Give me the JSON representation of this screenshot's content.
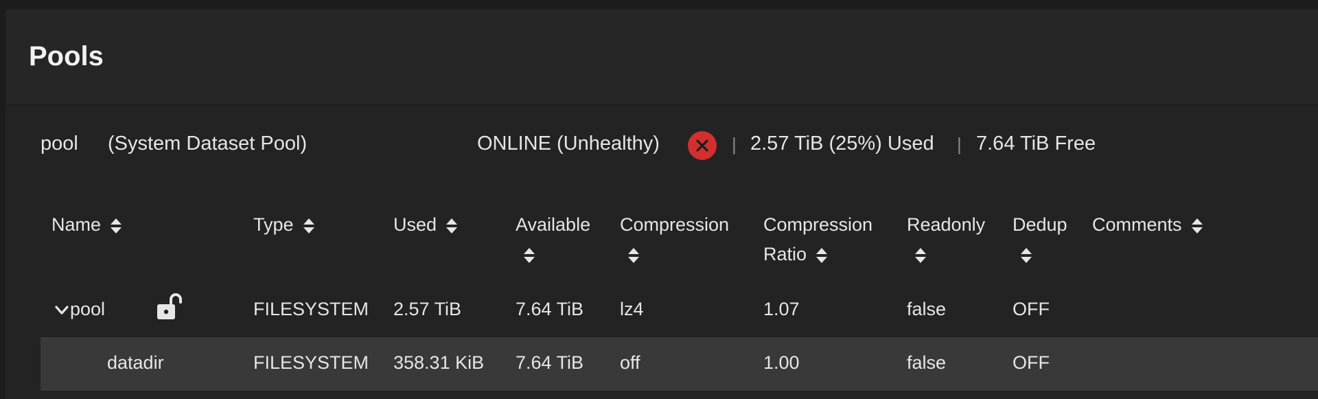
{
  "header": {
    "title": "Pools"
  },
  "pool": {
    "name": "pool",
    "role": "(System Dataset Pool)",
    "status": "ONLINE (Unhealthy)",
    "separator": "|",
    "used": "2.57 TiB (25%) Used",
    "free": "7.64 TiB Free",
    "status_color": "#d32f2f"
  },
  "table": {
    "columns": {
      "name": "Name",
      "type": "Type",
      "used": "Used",
      "available": "Available",
      "compression": "Compression",
      "ratio_line1": "Compression",
      "ratio_line2": "Ratio",
      "readonly": "Readonly",
      "dedup": "Dedup",
      "comments": "Comments"
    },
    "rows": [
      {
        "name": "pool",
        "type": "FILESYSTEM",
        "used": "2.57 TiB",
        "available": "7.64 TiB",
        "compression": "lz4",
        "ratio": "1.07",
        "readonly": "false",
        "dedup": "OFF",
        "comments": ""
      },
      {
        "name": "datadir",
        "type": "FILESYSTEM",
        "used": "358.31 KiB",
        "available": "7.64 TiB",
        "compression": "off",
        "ratio": "1.00",
        "readonly": "false",
        "dedup": "OFF",
        "comments": ""
      }
    ]
  },
  "icons": {
    "status": "close-circle-icon",
    "lock": "lock-open-icon",
    "expand": "chevron-down-icon",
    "sort": "sort-icon"
  }
}
